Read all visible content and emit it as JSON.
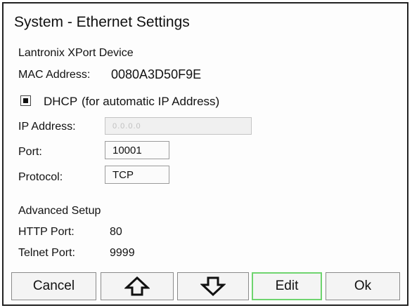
{
  "window": {
    "title": "System - Ethernet Settings"
  },
  "device": {
    "name": "Lantronix XPort Device",
    "mac_label": "MAC Address:",
    "mac_value": "0080A3D50F9E"
  },
  "dhcp": {
    "label": "DHCP",
    "hint": "(for automatic  IP Address)",
    "checked": true
  },
  "fields": {
    "ip_label": "IP Address:",
    "ip_value": "0.0.0.0",
    "port_label": "Port:",
    "port_value": "10001",
    "protocol_label": "Protocol:",
    "protocol_value": "TCP"
  },
  "advanced": {
    "heading": "Advanced Setup",
    "http_label": "HTTP Port:",
    "http_value": "80",
    "telnet_label": "Telnet Port:",
    "telnet_value": "9999"
  },
  "buttons": {
    "cancel": "Cancel",
    "up_icon": "arrow-up-icon",
    "down_icon": "arrow-down-icon",
    "edit": "Edit",
    "ok": "Ok"
  },
  "colors": {
    "focus": "#6fd46f",
    "border": "#222222"
  }
}
